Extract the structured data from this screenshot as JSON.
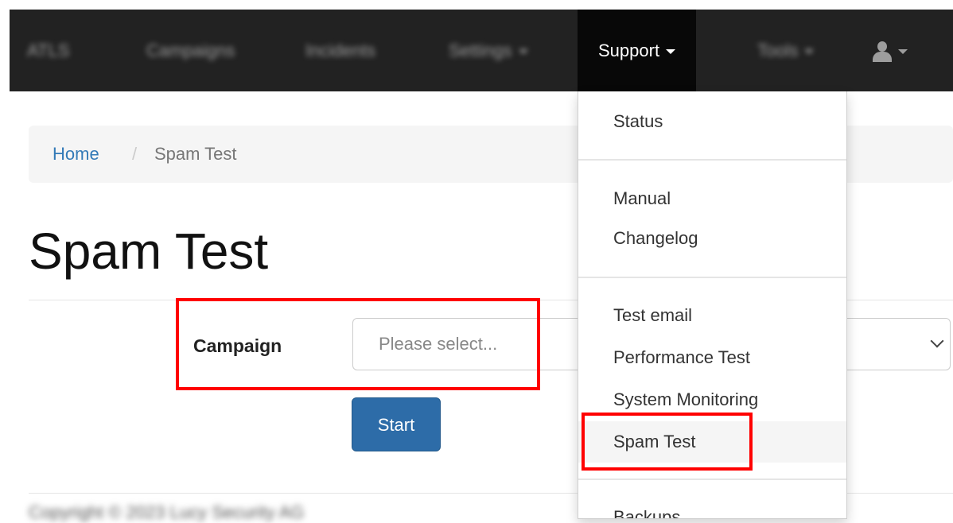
{
  "navbar": {
    "brand": "ATLS",
    "items": [
      {
        "label": "Campaigns"
      },
      {
        "label": "Incidents"
      },
      {
        "label": "Settings"
      },
      {
        "label": "Support"
      },
      {
        "label": "Tools"
      }
    ]
  },
  "breadcrumb": {
    "home": "Home",
    "separator": "/",
    "current": "Spam Test"
  },
  "page": {
    "title": "Spam Test",
    "campaign_label": "Campaign",
    "campaign_placeholder": "Please select...",
    "start_label": "Start",
    "footer": "Copyright © 2023 Lucy Security AG"
  },
  "support_menu": {
    "items": [
      {
        "label": "Status"
      },
      {
        "label": "Manual"
      },
      {
        "label": "Changelog"
      },
      {
        "label": "Test email"
      },
      {
        "label": "Performance Test"
      },
      {
        "label": "System Monitoring"
      },
      {
        "label": "Spam Test",
        "selected": true
      },
      {
        "label": "Backups"
      }
    ]
  },
  "colors": {
    "navbar": "#222222",
    "link": "#337ab7",
    "primary_button": "#2d6ca8",
    "highlight": "#ff0000"
  },
  "icons": [
    "caret-down-icon",
    "user-icon",
    "chevron-down-icon"
  ]
}
